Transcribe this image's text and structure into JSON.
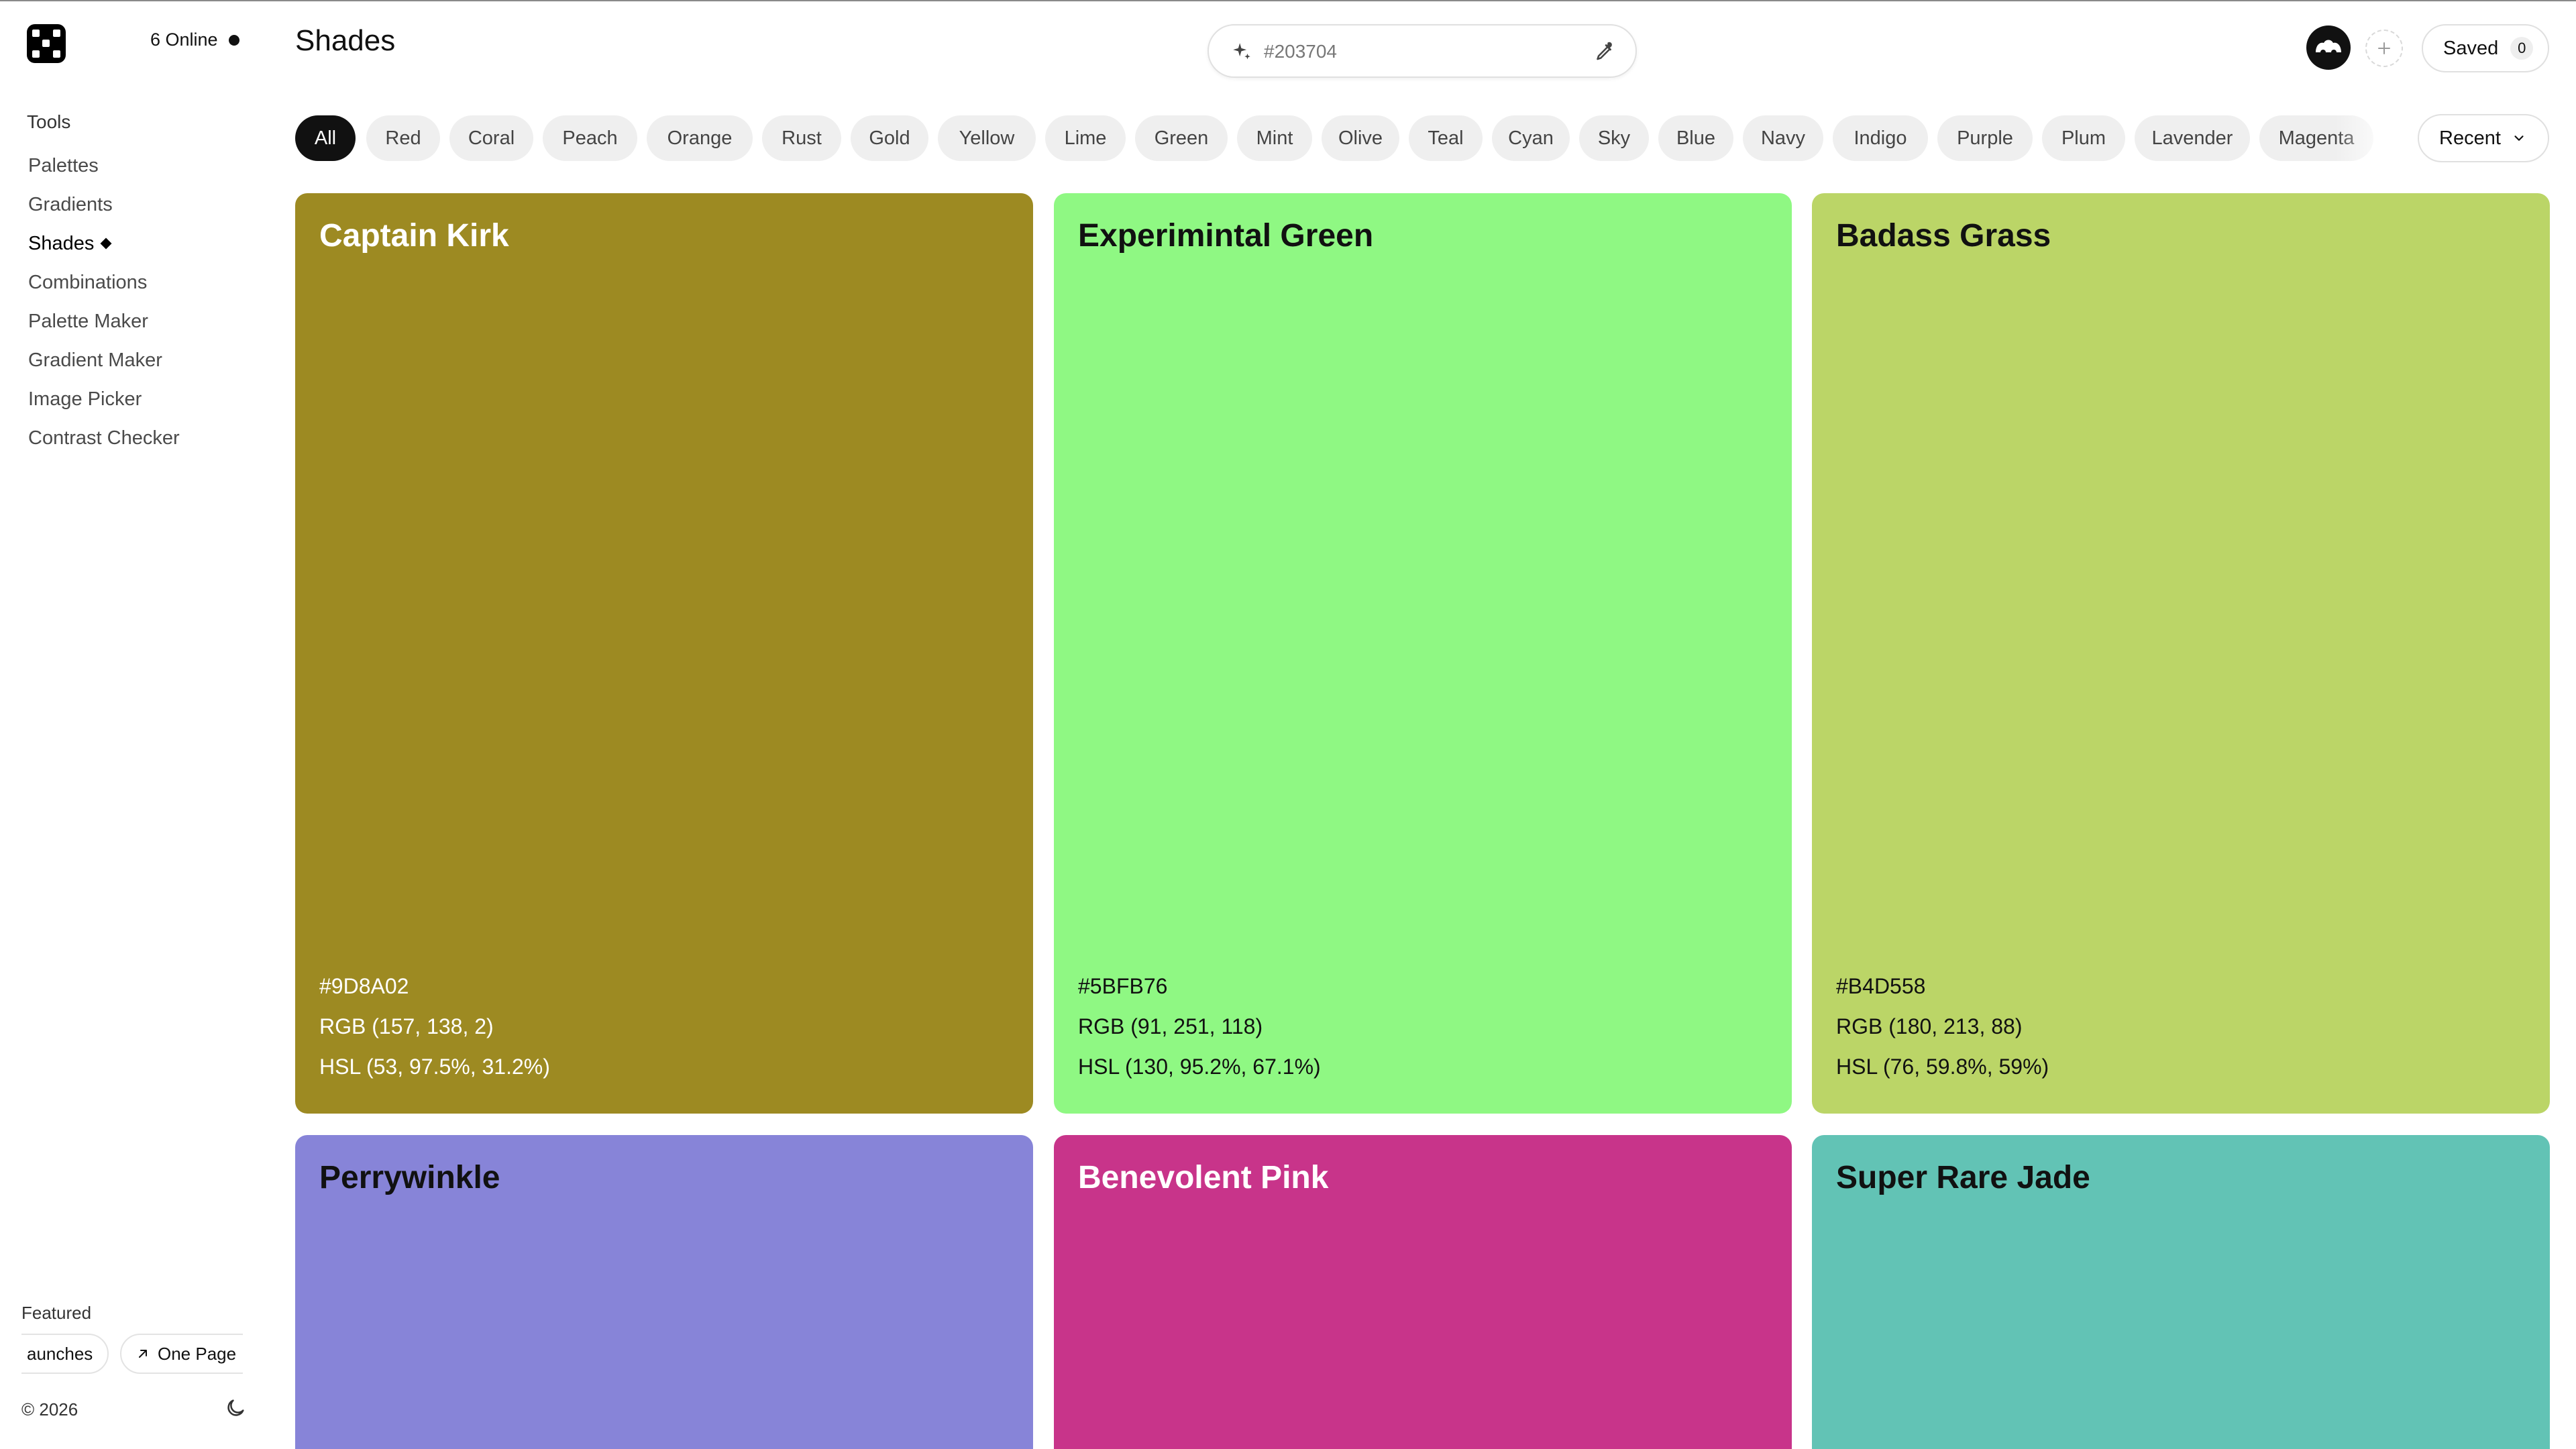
{
  "app": {
    "online_text": "6 Online",
    "page_title": "Shades"
  },
  "sidebar": {
    "section_title": "Tools",
    "items": [
      {
        "label": "Palettes",
        "active": false
      },
      {
        "label": "Gradients",
        "active": false
      },
      {
        "label": "Shades",
        "active": true
      },
      {
        "label": "Combinations",
        "active": false
      },
      {
        "label": "Palette Maker",
        "active": false
      },
      {
        "label": "Gradient Maker",
        "active": false
      },
      {
        "label": "Image Picker",
        "active": false
      },
      {
        "label": "Contrast Checker",
        "active": false
      }
    ],
    "featured_label": "Featured",
    "featured": [
      "aunches",
      "One Page"
    ],
    "copyright": "© 2026"
  },
  "search": {
    "placeholder": "#203704",
    "value": ""
  },
  "header": {
    "saved_label": "Saved",
    "saved_count": "0"
  },
  "filters": {
    "chips": [
      "All",
      "Red",
      "Coral",
      "Peach",
      "Orange",
      "Rust",
      "Gold",
      "Yellow",
      "Lime",
      "Green",
      "Mint",
      "Olive",
      "Teal",
      "Cyan",
      "Sky",
      "Blue",
      "Navy",
      "Indigo",
      "Purple",
      "Plum",
      "Lavender",
      "Magenta"
    ],
    "active": "All",
    "sort_label": "Recent"
  },
  "cards": [
    {
      "name": "Captain Kirk",
      "color": "#9D8A22",
      "text_color": "#ffffff",
      "hex": "#9D8A02",
      "rgb": "RGB (157, 138, 2)",
      "hsl": "HSL (53, 97.5%, 31.2%)"
    },
    {
      "name": "Experimintal Green",
      "color": "#8FF883",
      "text_color": "#111111",
      "hex": "#5BFB76",
      "rgb": "RGB (91, 251, 118)",
      "hsl": "HSL (130, 95.2%, 67.1%)"
    },
    {
      "name": "Badass Grass",
      "color": "#BBD567",
      "text_color": "#111111",
      "hex": "#B4D558",
      "rgb": "RGB (180, 213, 88)",
      "hsl": "HSL (76, 59.8%, 59%)"
    },
    {
      "name": "Perrywinkle",
      "color": "#8784D8",
      "text_color": "#111111"
    },
    {
      "name": "Benevolent Pink",
      "color": "#C8348A",
      "text_color": "#ffffff"
    },
    {
      "name": "Super Rare Jade",
      "color": "#62C3B5",
      "text_color": "#111111"
    }
  ],
  "icons": {
    "logo": "logo-icon",
    "status": "status-dot-icon",
    "sparkle": "sparkle-icon",
    "dropper": "eyedropper-icon",
    "plus": "plus-icon",
    "chevron": "chevron-down-icon",
    "arrow": "arrow-up-right-icon",
    "moon": "moon-icon",
    "avatar": "avatar-icon"
  }
}
